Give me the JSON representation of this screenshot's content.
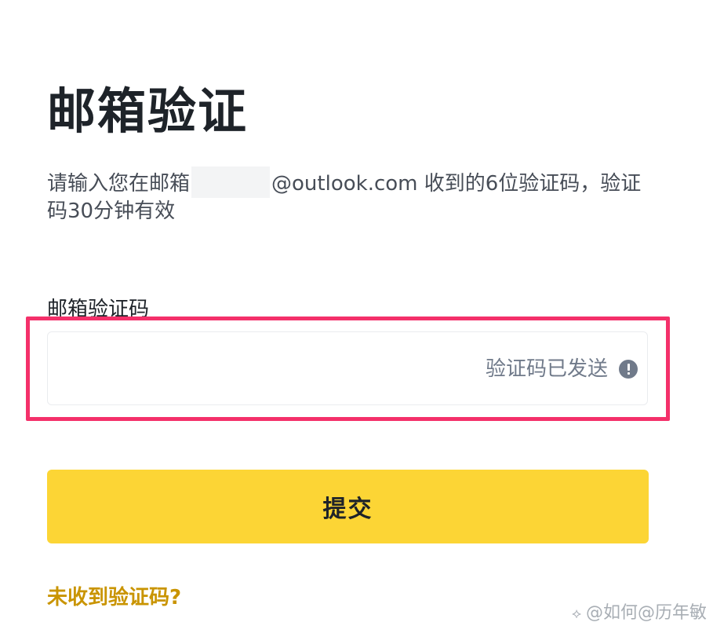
{
  "header": {
    "title": "邮箱验证"
  },
  "description": {
    "prefix": "请输入您在邮箱",
    "suffix": "@outlook.com 收到的6位验证码，验证码30分钟有效"
  },
  "form": {
    "field_label": "邮箱验证码",
    "code_value": "",
    "status_text": "验证码已发送",
    "status_icon": "exclamation-circle-icon",
    "submit_label": "提交",
    "resend_link": "未收到验证码?"
  },
  "colors": {
    "primary_button": "#fcd535",
    "link": "#c99400",
    "highlight_border": "#f4306a",
    "status_text": "#707a8a"
  },
  "watermark": {
    "icon": "share-icon",
    "text": "@如何@历年敏"
  }
}
